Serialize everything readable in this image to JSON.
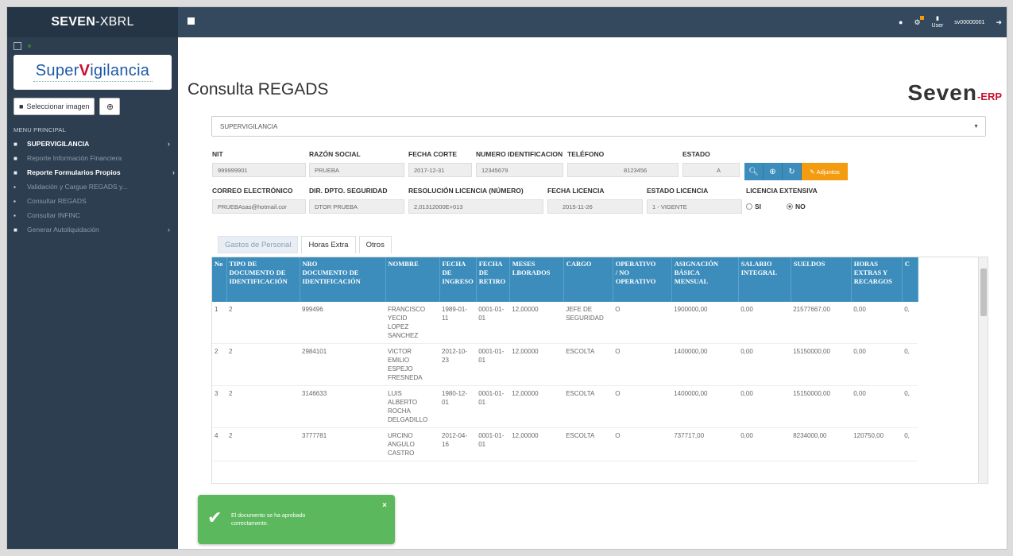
{
  "app": {
    "brand_bold": "SEVEN",
    "brand_rest": "-XBRL"
  },
  "topbar": {
    "user_label": "User",
    "username": "sv00000001"
  },
  "sidebar": {
    "logo_super": "Super",
    "logo_v": "V",
    "logo_rest": "igilancia",
    "select_image_label": "Seleccionar imagen",
    "menu_title": "MENU PRINCIPAL",
    "items": [
      {
        "label": "SUPERVIGILANCIA"
      },
      {
        "label": "Reporte Información Financiera"
      },
      {
        "label": "Reporte Formularios Propios"
      },
      {
        "label": "Validación y Cargue REGADS y..."
      },
      {
        "label": "Consultar REGADS"
      },
      {
        "label": "Consultar INFINC"
      },
      {
        "label": "Generar Autoliquidación"
      }
    ]
  },
  "header": {
    "title": "Consulta REGADS",
    "logo_seven": "Seven",
    "logo_erp": "-ERP"
  },
  "form": {
    "entity_select": "SUPERVIGILANCIA",
    "labels": {
      "nit": "NIT",
      "razon": "RAZÓN SOCIAL",
      "fecha_corte": "FECHA CORTE",
      "numero_id": "NUMERO IDENTIFICACION",
      "telefono": "TELÉFONO",
      "estado": "ESTADO",
      "correo": "CORREO ELECTRÓNICO",
      "dir_dpto": "DIR. DPTO. SEGURIDAD",
      "resolucion": "RESOLUCIÓN LICENCIA (NÚMERO)",
      "fecha_licencia": "FECHA LICENCIA",
      "estado_licencia": "ESTADO LICENCIA",
      "licencia_extensiva": "LICENCIA EXTENSIVA"
    },
    "values": {
      "nit": "999999901",
      "razon": "PRUEBA",
      "fecha_corte": "2017-12-31",
      "numero_id": "12345679",
      "telefono": "8123456",
      "estado": "A",
      "correo": "PRUEBAsas@hotmail.cor",
      "dir_dpto": "DTOR PRUEBA",
      "resolucion": "2,01312000E+013",
      "fecha_licencia": "2015-11-26",
      "estado_licencia": "1 - VIGENTE"
    },
    "radio_si": "SI",
    "radio_no": "NO",
    "adjuntos_label": "Adjuntos"
  },
  "tabs": [
    {
      "label": "Gastos de Personal"
    },
    {
      "label": "Horas Extra"
    },
    {
      "label": "Otros"
    }
  ],
  "table": {
    "headers": [
      "No",
      "TIPO DE\nDOCUMENTO DE\nIDENTIFICACIÓN",
      "NRO\nDOCUMENTO DE\nIDENTIFICACIÓN",
      "NOMBRE",
      "FECHA\nDE\nINGRESO",
      "FECHA\nDE\nRETIRO",
      "MESES\nLBORADOS",
      "CARGO",
      "OPERATIVO\n/ NO\nOPERATIVO",
      "ASIGNACIÓN\nBÁSICA\nMENSUAL",
      "SALARIO\nINTEGRAL",
      "SUELDOS",
      "HORAS\nEXTRAS Y\nRECARGOS",
      "C"
    ],
    "rows": [
      [
        "1",
        "2",
        "999496",
        "FRANCISCO\nYECID\nLOPEZ\nSANCHEZ",
        "1989-01-\n11",
        "0001-01-\n01",
        "12,00000",
        "JEFE DE\nSEGURIDAD",
        "O",
        "1900000,00",
        "0,00",
        "21577667,00",
        "0,00",
        "0,"
      ],
      [
        "2",
        "2",
        "2984101",
        "VICTOR\nEMILIO\nESPEJO\nFRESNEDA",
        "2012-10-\n23",
        "0001-01-\n01",
        "12,00000",
        "ESCOLTA",
        "O",
        "1400000,00",
        "0,00",
        "15150000,00",
        "0,00",
        "0,"
      ],
      [
        "3",
        "2",
        "3146633",
        "LUIS\nALBERTO\nROCHA\nDELGADILLO",
        "1980-12-\n01",
        "0001-01-\n01",
        "12,00000",
        "ESCOLTA",
        "O",
        "1400000,00",
        "0,00",
        "15150000,00",
        "0,00",
        "0,"
      ],
      [
        "4",
        "2",
        "3777781",
        "URCINO\nANGULO\nCASTRO",
        "2012-04-\n16",
        "0001-01-\n01",
        "12,00000",
        "ESCOLTA",
        "O",
        "737717,00",
        "0,00",
        "8234000,00",
        "120750,00",
        "0,"
      ]
    ]
  },
  "toast": {
    "message": "El documento se ha aprobado correctamente."
  },
  "colors": {
    "sidebar": "#2d3e50",
    "topbar": "#34495e",
    "table_header": "#3c8dbc",
    "adjuntos": "#f39c12",
    "toast": "#5cb85c"
  }
}
